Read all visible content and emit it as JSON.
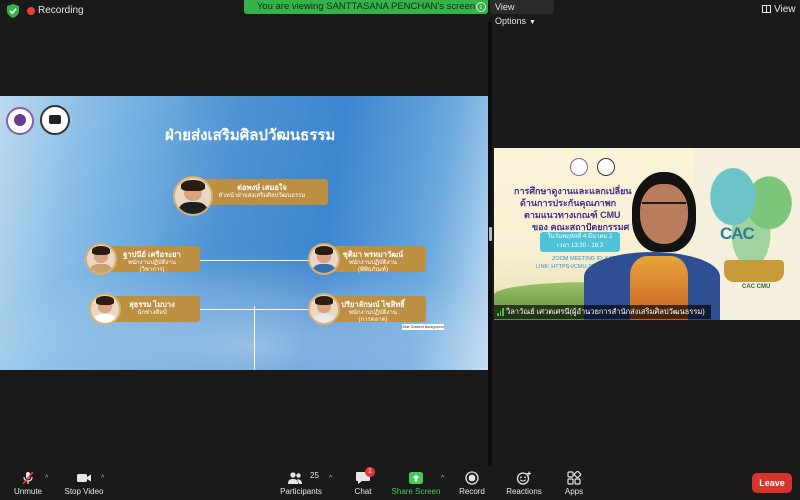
{
  "topbar": {
    "recording_label": "Recording",
    "viewing_banner": "You are viewing SANTTASANA PENCHAN's screen",
    "view_options_label": "View Options",
    "view_label": "View"
  },
  "slide": {
    "title": "ฝ่ายส่งเสริมศิลปวัฒนธรรม",
    "staff": [
      {
        "name": "ต่อพงษ์ เสมอใจ",
        "position": "หัวหน้าฝ่ายส่งเสริมศิลปวัฒนธรรม"
      },
      {
        "name": "ฐาปนีย์ เครือระยา",
        "position": "พนักงานปฏิบัติงาน\n(วิชาการ)"
      },
      {
        "name": "ชุติมา พรหมาวัฒน์",
        "position": "พนักงานปฏิบัติงาน\n(พิพิธภัณฑ์)"
      },
      {
        "name": "สุธรรม ไมบาง",
        "position": "นักช่างศิลป์"
      },
      {
        "name": "ปรียาลักษณ์ ไชสิทธิ์",
        "position": "พนักงานปฏิบัติงาน\n(การตลาด)"
      }
    ],
    "watermark": "Blue Gradient Background"
  },
  "video": {
    "poster_lines": [
      "การศึกษาดูงานและแลกเปลี่ยน",
      "ด้านการประกันคุณภาพก",
      "ตามแนวทางเกณฑ์ CMU",
      "ของ คณะสถาปัตยกรรมศ"
    ],
    "poster_date": "ในวันพฤหัสที่ 4 มีนาคม 2",
    "poster_time": "เวลา 13:30 - 16:3",
    "poster_zoom": "ZOOM MEETING ID: 643 4",
    "poster_link": "LINK: HTTPS://CMU-TH.ZOOM.US",
    "poster_logo_text": "CAC",
    "poster_logo_sub": "CAC CMU",
    "participant_name": "วิลาวัณย์ เศวตเศรนี(ผู้อำนวยการสำนักส่งเสริมศิลปวัฒนธรรม)"
  },
  "toolbar": {
    "unmute": "Unmute",
    "stop_video": "Stop Video",
    "participants": "Participants",
    "participants_count": "25",
    "chat": "Chat",
    "chat_badge": "1",
    "share_screen": "Share Screen",
    "record": "Record",
    "reactions": "Reactions",
    "apps": "Apps",
    "leave": "Leave"
  },
  "colors": {
    "recording": "#e8413c",
    "banner": "#36b24a",
    "card_gold": "#bc8f43",
    "share_green": "#3fcc58",
    "leave_red": "#d9342c"
  }
}
